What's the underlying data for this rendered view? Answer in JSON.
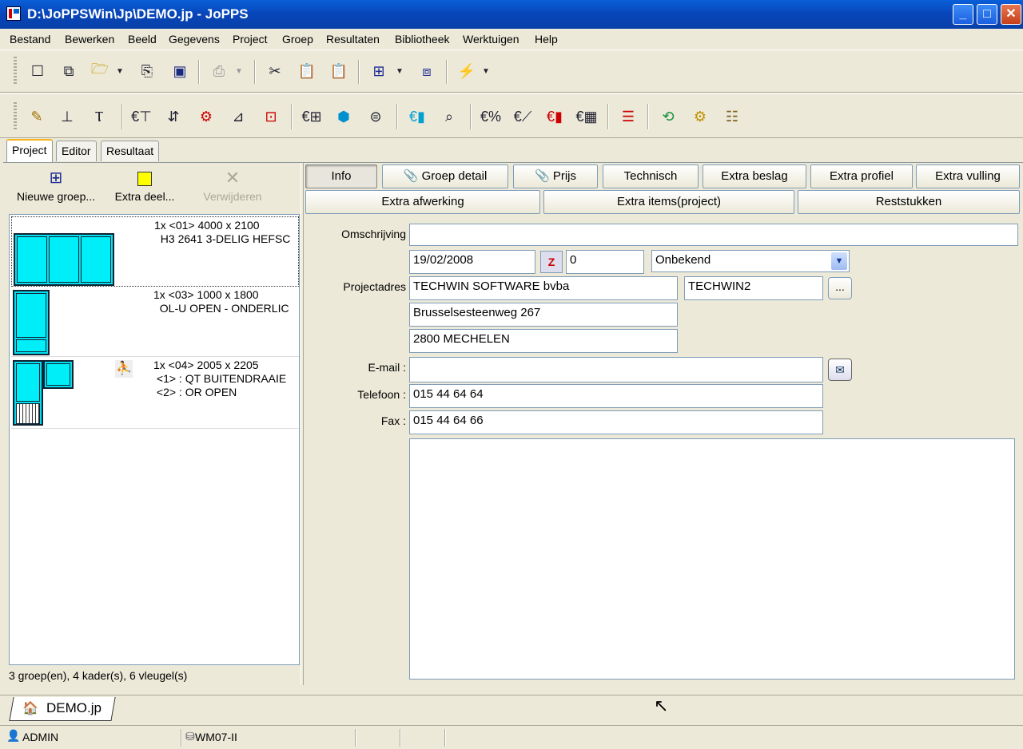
{
  "window": {
    "title": "D:\\JoPPSWin\\Jp\\DEMO.jp - JoPPS",
    "min": "_",
    "max": "□",
    "close": "✕"
  },
  "menu": [
    "Bestand",
    "Bewerken",
    "Beeld",
    "Gegevens",
    "Project",
    "Groep",
    "Resultaten",
    "Bibliotheek",
    "Werktuigen",
    "Help"
  ],
  "toolbar1_icons": [
    "new-icon",
    "copy-doc-icon",
    "open-folder-icon",
    "dropdown-icon",
    "export-icon",
    "save-icon",
    "print-icon",
    "dropdown-icon",
    "cut-icon",
    "paste-icon",
    "paste-special-icon",
    "new-group-icon",
    "dropdown-icon",
    "window-icon",
    "lightning-icon",
    "dropdown-icon"
  ],
  "main_tabs": [
    "Project",
    "Editor",
    "Resultaat"
  ],
  "left_actions": {
    "new_group": "Nieuwe groep...",
    "extra_part": "Extra deel...",
    "remove": "Verwijderen"
  },
  "groups": [
    {
      "line1": "1x <01> 4000 x 2100",
      "line2": "  H3 2641 3-DELIG HEFSC",
      "line3": ""
    },
    {
      "line1": "1x <03> 1000 x 1800",
      "line2": "  OL-U OPEN - ONDERLIC",
      "line3": ""
    },
    {
      "line1": "1x <04> 2005 x 2205",
      "line2": " <1> : QT BUITENDRAAIE",
      "line3": " <2> : OR OPEN"
    }
  ],
  "left_status": "3 groep(en), 4 kader(s), 6 vleugel(s)",
  "info_tabs_row1": [
    "Info",
    "Groep detail",
    "Prijs",
    "Technisch",
    "Extra beslag",
    "Extra profiel",
    "Extra vulling"
  ],
  "info_tabs_row2": [
    "Extra afwerking",
    "Extra items(project)",
    "Reststukken"
  ],
  "form": {
    "description_label": "Omschrijving",
    "description": "",
    "date": "19/02/2008",
    "number": "0",
    "status": "Onbekend",
    "address_label": "Projectadres",
    "company": "TECHWIN SOFTWARE bvba",
    "code": "TECHWIN2",
    "browse": "...",
    "street": "Brusselsesteenweg 267",
    "city": "2800 MECHELEN",
    "email_label": "E-mail :",
    "email": "",
    "phone_label": "Telefoon :",
    "phone": "015 44 64 64",
    "fax_label": "Fax :",
    "fax": "015 44 64 66",
    "notes": ""
  },
  "doc_tab": "DEMO.jp",
  "statusbar": {
    "user": "ADMIN",
    "db": "WM07-II"
  }
}
